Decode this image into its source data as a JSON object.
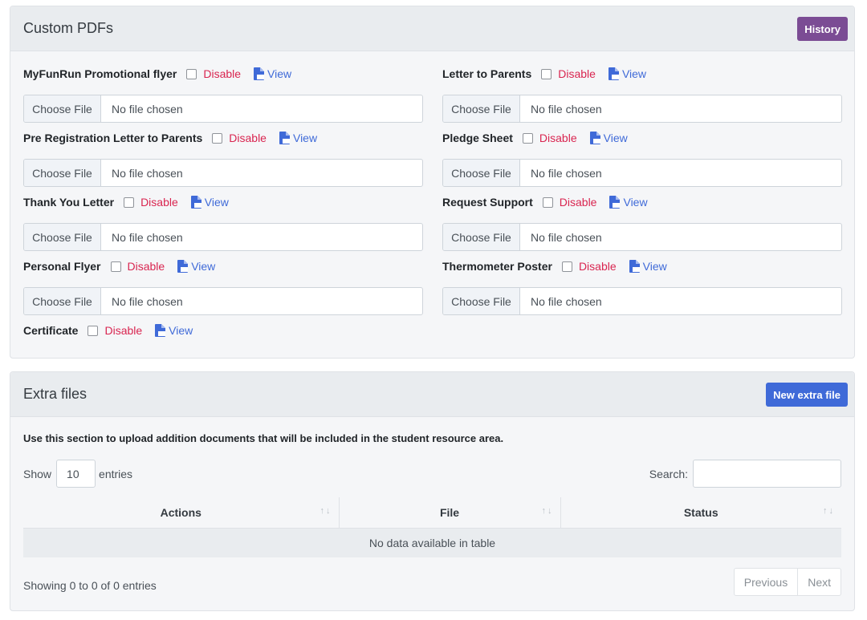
{
  "custom_pdfs": {
    "title": "Custom PDFs",
    "history_button": "History",
    "disable_label": "Disable",
    "view_label": "View",
    "choose_file_label": "Choose File",
    "no_file_label": "No file chosen",
    "fields": [
      {
        "name": "MyFunRun Promotional flyer"
      },
      {
        "name": "Letter to Parents"
      },
      {
        "name": "Pre Registration Letter to Parents"
      },
      {
        "name": "Pledge Sheet"
      },
      {
        "name": "Thank You Letter"
      },
      {
        "name": "Request Support"
      },
      {
        "name": "Personal Flyer"
      },
      {
        "name": "Thermometer Poster"
      },
      {
        "name": "Certificate"
      }
    ]
  },
  "extra_files": {
    "title": "Extra files",
    "new_button": "New extra file",
    "description": "Use this section to upload addition documents that will be included in the student resource area.",
    "show_label": "Show",
    "entries_value": "10",
    "entries_label": "entries",
    "search_label": "Search:",
    "columns": [
      "Actions",
      "File",
      "Status"
    ],
    "empty_message": "No data available in table",
    "info": "Showing 0 to 0 of 0 entries",
    "prev_label": "Previous",
    "next_label": "Next"
  },
  "icons": {
    "pdf_icon_color": "#3f6ad8"
  },
  "colors": {
    "history_button": "#7b4c94",
    "new_button": "#3f6ad8",
    "disable_text": "#d92550",
    "view_link": "#3f6ad8"
  }
}
